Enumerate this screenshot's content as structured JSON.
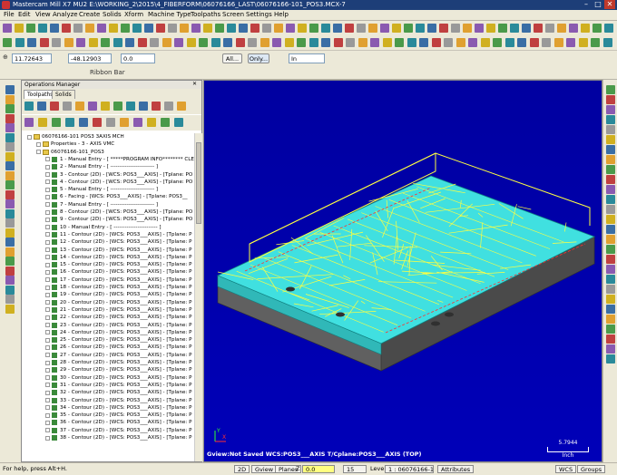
{
  "window": {
    "title": "Mastercam Mill X7 MU2  E:\\WORKING_2\\2015\\4_FIBERFORM\\06076166_LAST\\06076166-101_POS3.MCX-7",
    "controls": [
      "–",
      "□",
      "✕"
    ]
  },
  "menu": [
    "File",
    "Edit",
    "View",
    "Analyze",
    "Create",
    "Solids",
    "Xform",
    "Machine Type",
    "Toolpaths",
    "Screen",
    "Settings",
    "Help"
  ],
  "ribbon": {
    "x_value": "11.72643",
    "y_value": "-48.12903",
    "z_value": "0.0",
    "all_label": "All...",
    "only_label": "Only...",
    "mode_value": "In",
    "bar_label": "Ribbon Bar"
  },
  "ops_manager": {
    "title": "Operations Manager",
    "tabs": [
      "Toolpaths",
      "Solids"
    ],
    "tree": [
      {
        "level": 0,
        "text": "06076166-101 POS3 3AXIS MCH",
        "type": "machine"
      },
      {
        "level": 1,
        "text": "Properties - 3 - AXIS VMC",
        "type": "props"
      },
      {
        "level": 1,
        "text": "06076166-101_POS3",
        "type": "group"
      },
      {
        "level": 2,
        "text": "1 - Manual Entry - [ *****PROGRAM INFO******** CLE",
        "type": "op"
      },
      {
        "level": 2,
        "text": "2 - Manual Entry - [ ------------------------ ]",
        "type": "op"
      },
      {
        "level": 2,
        "text": "3 - Contour (2D) - [WCS: POS3___AXIS] - [Tplane: PO",
        "type": "op"
      },
      {
        "level": 2,
        "text": "4 - Contour (2D) - [WCS: POS3___AXIS] - [Tplane: PO",
        "type": "op"
      },
      {
        "level": 2,
        "text": "5 - Manual Entry - [ ------------------------ ]",
        "type": "op"
      },
      {
        "level": 2,
        "text": "6 - Facing - [WCS: POS3___AXIS] - [Tplane: POS3__",
        "type": "op"
      },
      {
        "level": 2,
        "text": "7 - Manual Entry - [ ------------------------ ]",
        "type": "op"
      },
      {
        "level": 2,
        "text": "8 - Contour (2D) - [WCS: POS3___AXIS] - [Tplane: PO",
        "type": "op"
      },
      {
        "level": 2,
        "text": "9 - Contour (2D) - [WCS: POS3___AXIS] - [Tplane: PO",
        "type": "op"
      },
      {
        "level": 2,
        "text": "10 - Manual Entry - [ ------------------------ ]",
        "type": "op"
      },
      {
        "level": 2,
        "text": "11 - Contour (2D) - [WCS: POS3___AXIS] - [Tplane: P",
        "type": "op"
      },
      {
        "level": 2,
        "text": "12 - Contour (2D) - [WCS: POS3___AXIS] - [Tplane: P",
        "type": "op"
      },
      {
        "level": 2,
        "text": "13 - Contour (2D) - [WCS: POS3___AXIS] - [Tplane: P",
        "type": "op"
      },
      {
        "level": 2,
        "text": "14 - Contour (2D) - [WCS: POS3___AXIS] - [Tplane: P",
        "type": "op"
      },
      {
        "level": 2,
        "text": "15 - Contour (2D) - [WCS: POS3___AXIS] - [Tplane: P",
        "type": "op"
      },
      {
        "level": 2,
        "text": "16 - Contour (2D) - [WCS: POS3___AXIS] - [Tplane: P",
        "type": "op"
      },
      {
        "level": 2,
        "text": "17 - Contour (2D) - [WCS: POS3___AXIS] - [Tplane: P",
        "type": "op"
      },
      {
        "level": 2,
        "text": "18 - Contour (2D) - [WCS: POS3___AXIS] - [Tplane: P",
        "type": "op"
      },
      {
        "level": 2,
        "text": "19 - Contour (2D) - [WCS: POS3___AXIS] - [Tplane: P",
        "type": "op"
      },
      {
        "level": 2,
        "text": "20 - Contour (2D) - [WCS: POS3___AXIS] - [Tplane: P",
        "type": "op"
      },
      {
        "level": 2,
        "text": "21 - Contour (2D) - [WCS: POS3___AXIS] - [Tplane: P",
        "type": "op"
      },
      {
        "level": 2,
        "text": "22 - Contour (2D) - [WCS: POS3___AXIS] - [Tplane: P",
        "type": "op"
      },
      {
        "level": 2,
        "text": "23 - Contour (2D) - [WCS: POS3___AXIS] - [Tplane: P",
        "type": "op"
      },
      {
        "level": 2,
        "text": "24 - Contour (2D) - [WCS: POS3___AXIS] - [Tplane: P",
        "type": "op"
      },
      {
        "level": 2,
        "text": "25 - Contour (2D) - [WCS: POS3___AXIS] - [Tplane: P",
        "type": "op"
      },
      {
        "level": 2,
        "text": "26 - Contour (2D) - [WCS: POS3___AXIS] - [Tplane: P",
        "type": "op"
      },
      {
        "level": 2,
        "text": "27 - Contour (2D) - [WCS: POS3___AXIS] - [Tplane: P",
        "type": "op"
      },
      {
        "level": 2,
        "text": "28 - Contour (2D) - [WCS: POS3___AXIS] - [Tplane: P",
        "type": "op"
      },
      {
        "level": 2,
        "text": "29 - Contour (2D) - [WCS: POS3___AXIS] - [Tplane: P",
        "type": "op"
      },
      {
        "level": 2,
        "text": "30 - Contour (2D) - [WCS: POS3___AXIS] - [Tplane: P",
        "type": "op"
      },
      {
        "level": 2,
        "text": "31 - Contour (2D) - [WCS: POS3___AXIS] - [Tplane: P",
        "type": "op"
      },
      {
        "level": 2,
        "text": "32 - Contour (2D) - [WCS: POS3___AXIS] - [Tplane: P",
        "type": "op"
      },
      {
        "level": 2,
        "text": "33 - Contour (2D) - [WCS: POS3___AXIS] - [Tplane: P",
        "type": "op"
      },
      {
        "level": 2,
        "text": "34 - Contour (2D) - [WCS: POS3___AXIS] - [Tplane: P",
        "type": "op"
      },
      {
        "level": 2,
        "text": "35 - Contour (2D) - [WCS: POS3___AXIS] - [Tplane: P",
        "type": "op"
      },
      {
        "level": 2,
        "text": "36 - Contour (2D) - [WCS: POS3___AXIS] - [Tplane: P",
        "type": "op"
      },
      {
        "level": 2,
        "text": "37 - Contour (2D) - [WCS: POS3___AXIS] - [Tplane: P",
        "type": "op"
      },
      {
        "level": 2,
        "text": "38 - Contour (2D) - [WCS: POS3___AXIS] - [Tplane: P",
        "type": "op"
      }
    ]
  },
  "viewport": {
    "status": "Gview:Not Saved   WCS:POS3___AXIS   T/Cplane:POS3___AXIS (TOP)",
    "scale_value": "5.7944",
    "scale_unit": "Inch",
    "axis_x": "X",
    "axis_y": "Y",
    "colors": {
      "background": "#0000b0",
      "part": "#40e0e0",
      "toolpath": "#ffff40",
      "base": "#606060"
    }
  },
  "statusbar": {
    "help": "For help, press Alt+H.",
    "mode": "2D",
    "gview": "Gview",
    "planes": "Planes",
    "z_label": "Z",
    "z_value": "0.0",
    "color_value": "15",
    "level_label": "Level",
    "level_value": "1 : 06076166-1",
    "attributes": "Attributes",
    "wcs": "WCS",
    "groups": "Groups"
  }
}
